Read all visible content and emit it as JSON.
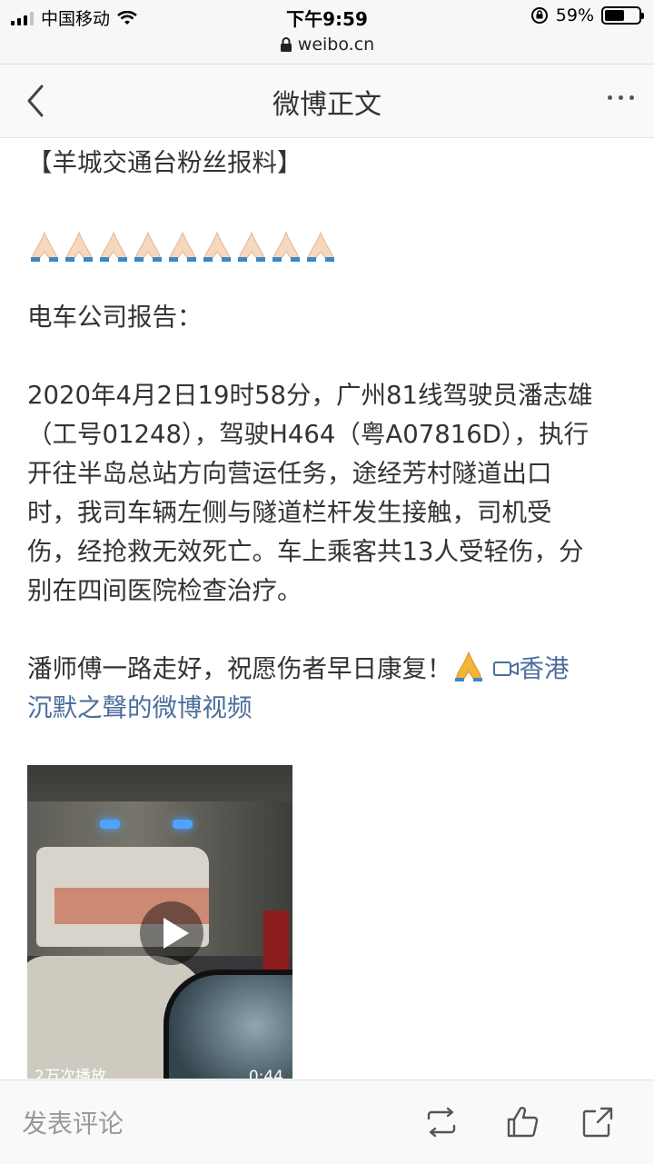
{
  "status_bar": {
    "carrier": "中国移动",
    "time": "下午9:59",
    "battery": "59%",
    "battery_level": 0.59
  },
  "url_bar": {
    "domain": "weibo.cn"
  },
  "nav": {
    "title": "微博正文",
    "back_icon": "chevron-left-icon",
    "more_icon": "more-dots-icon"
  },
  "post": {
    "heading": "【羊城交通台粉丝报料】",
    "emoji_count": 9,
    "report_title": "电车公司报告：",
    "lines": [
      "2020年4月2日19时58分，广州81线驾驶员潘志雄",
      "（工号01248），驾驶H464（粤A07816D），执行",
      "开往半岛总站方向营运任务，途经芳村隧道出口",
      "时，我司车辆左侧与隧道栏杆发生接触，司机受",
      "伤，经抢救无效死亡。车上乘客共13人受轻伤，分",
      "别在四间医院检查治疗。"
    ],
    "closing": "潘师傅一路走好，祝愿伤者早日康复！",
    "video_link_first": "香港",
    "video_link_rest": "沉默之聲的微博视频",
    "accent_color": "#4a6d9c"
  },
  "video": {
    "caption": "2万次播放",
    "duration": "0:44"
  },
  "bottom_bar": {
    "comment_placeholder": "发表评论",
    "icons": [
      "repost-icon",
      "like-icon",
      "share-icon"
    ]
  }
}
